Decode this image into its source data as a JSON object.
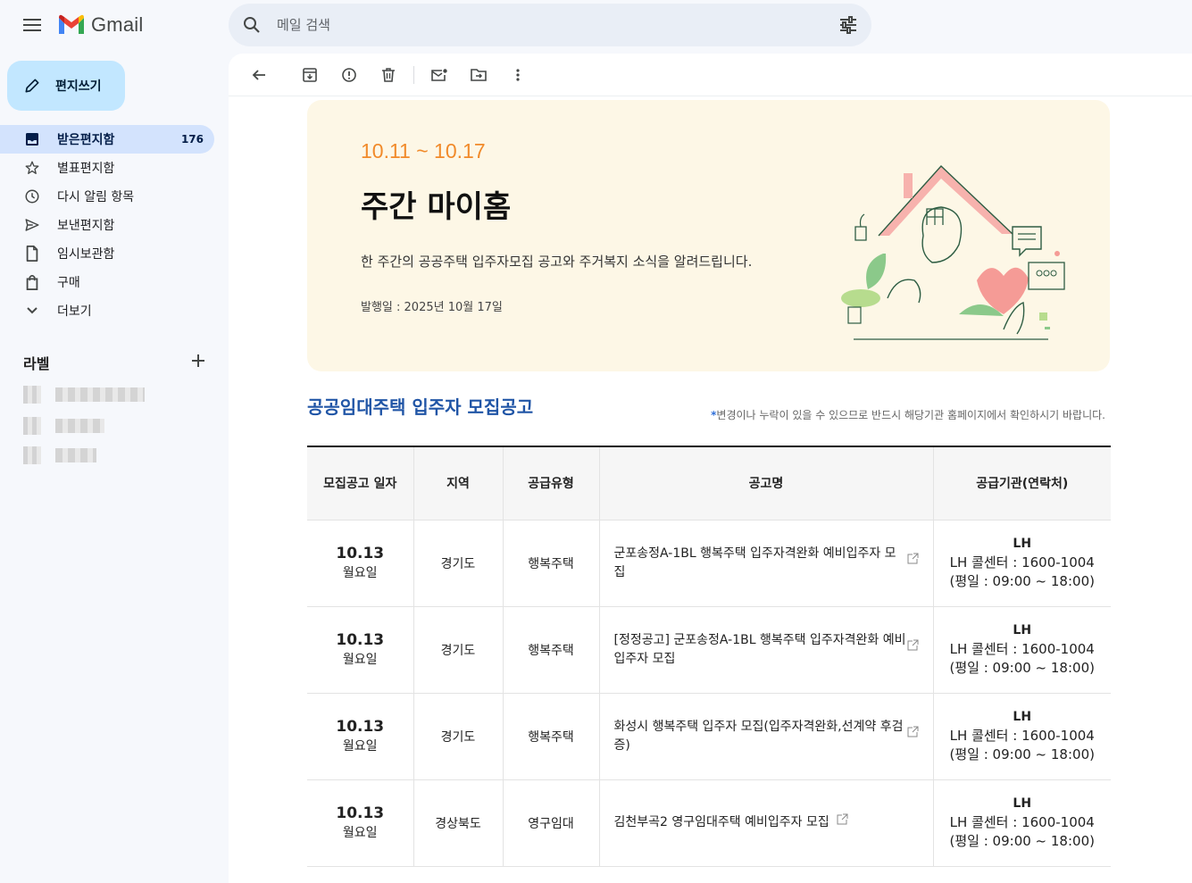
{
  "app": {
    "name": "Gmail",
    "search_placeholder": "메일 검색"
  },
  "sidebar": {
    "compose_label": "편지쓰기",
    "items": [
      {
        "label": "받은편지함",
        "count": "176",
        "icon": "inbox-icon"
      },
      {
        "label": "별표편지함",
        "icon": "star-icon"
      },
      {
        "label": "다시 알림 항목",
        "icon": "clock-icon"
      },
      {
        "label": "보낸편지함",
        "icon": "send-icon"
      },
      {
        "label": "임시보관함",
        "icon": "draft-icon"
      },
      {
        "label": "구매",
        "icon": "shopping-bag-icon"
      },
      {
        "label": "더보기",
        "icon": "chevron-down-icon"
      }
    ],
    "labels_heading": "라벨"
  },
  "toolbar": {
    "icons": [
      "back-icon",
      "archive-icon",
      "report-spam-icon",
      "delete-icon",
      "mark-unread-icon",
      "move-to-icon",
      "more-icon"
    ]
  },
  "newsletter": {
    "period": "10.11 ~ 10.17",
    "title": "주간 마이홈",
    "description": "한 주간의 공공주택 입주자모집 공고와 주거복지 소식을 알려드립니다.",
    "issue_date": "발행일 : 2025년 10월 17일",
    "section_title": "공공임대주택 입주자 모집공고",
    "note_star": "*",
    "note": "변경이나 누락이 있을 수 있으므로 반드시 해당기관 홈페이지에서 확인하시기 바랍니다.",
    "colors": {
      "accent_orange": "#f18a2a",
      "section_blue": "#2055a6",
      "hero_bg": "#fdf7e6"
    }
  },
  "table": {
    "headers": [
      "모집공고 일자",
      "지역",
      "공급유형",
      "공고명",
      "공급기관(연락처)"
    ],
    "rows": [
      {
        "date": "10.13",
        "weekday": "월요일",
        "region": "경기도",
        "type": "행복주택",
        "title": "군포송정A-1BL 행복주택 입주자격완화 예비입주자 모집",
        "org": "LH",
        "phone": "LH 콜센터 : 1600-1004",
        "hours": "(평일 : 09:00 ~ 18:00)"
      },
      {
        "date": "10.13",
        "weekday": "월요일",
        "region": "경기도",
        "type": "행복주택",
        "title": "[정정공고] 군포송정A-1BL 행복주택 입주자격완화 예비입주자 모집",
        "org": "LH",
        "phone": "LH 콜센터 : 1600-1004",
        "hours": "(평일 : 09:00 ~ 18:00)"
      },
      {
        "date": "10.13",
        "weekday": "월요일",
        "region": "경기도",
        "type": "행복주택",
        "title": "화성시 행복주택 입주자 모집(입주자격완화,선계약 후검증)",
        "org": "LH",
        "phone": "LH 콜센터 : 1600-1004",
        "hours": "(평일 : 09:00 ~ 18:00)"
      },
      {
        "date": "10.13",
        "weekday": "월요일",
        "region": "경상북도",
        "type": "영구임대",
        "title": "김천부곡2 영구임대주택 예비입주자 모집",
        "org": "LH",
        "phone": "LH 콜센터 : 1600-1004",
        "hours": "(평일 : 09:00 ~ 18:00)"
      }
    ]
  }
}
